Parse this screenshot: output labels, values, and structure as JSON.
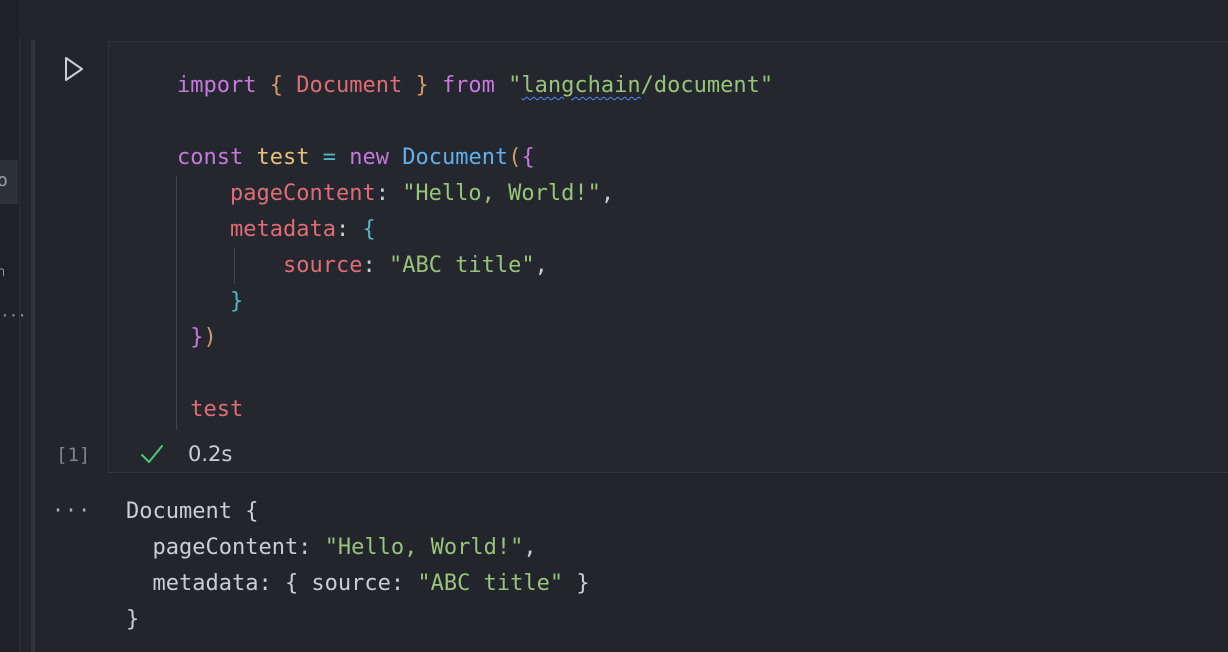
{
  "cell": {
    "execution_count": "[1]",
    "status_time": "0.2s",
    "code": {
      "l1": {
        "import_kw": "import",
        "brace_open": "{",
        "name": " Document ",
        "brace_close": "}",
        "from_kw": "from",
        "q1": "\"",
        "module_a": "langchain",
        "module_b": "/document",
        "q2": "\""
      },
      "l3": {
        "const_kw": "const",
        "var_name": "test",
        "eq": "=",
        "new_kw": "new",
        "cls_name": "Document",
        "paren": "(",
        "brace": "{"
      },
      "l4": {
        "key": "pageContent",
        "colon": ": ",
        "value": "\"Hello, World!\"",
        "comma": ","
      },
      "l5": {
        "key": "metadata",
        "colon": ": ",
        "brace": "{"
      },
      "l6": {
        "key": "source",
        "colon": ": ",
        "value": "\"ABC title\"",
        "comma": ","
      },
      "l7": {
        "brace": "}"
      },
      "l8": {
        "brace": "}",
        "paren": ")"
      },
      "l10": {
        "expr": "test"
      }
    }
  },
  "output": {
    "menu_glyph": "···",
    "o1": "Document {",
    "o2_key": "  pageContent: ",
    "o2_val": "\"Hello, World!\"",
    "o2_end": ",",
    "o3_key": "  metadata: { source: ",
    "o3_val": "\"ABC title\"",
    "o3_end": " }",
    "o4": "}"
  },
  "left_rail": {
    "tab_glyph": "o",
    "dots": "···"
  },
  "colors": {
    "background": "#22252c",
    "keyword": "#c678dd",
    "string": "#98c379",
    "class": "#e06c75",
    "function": "#61afef",
    "variable": "#e5c07b",
    "success": "#4ec86a"
  },
  "icons": {
    "run": "play-icon",
    "status": "check-icon",
    "output_menu": "more-icon"
  }
}
